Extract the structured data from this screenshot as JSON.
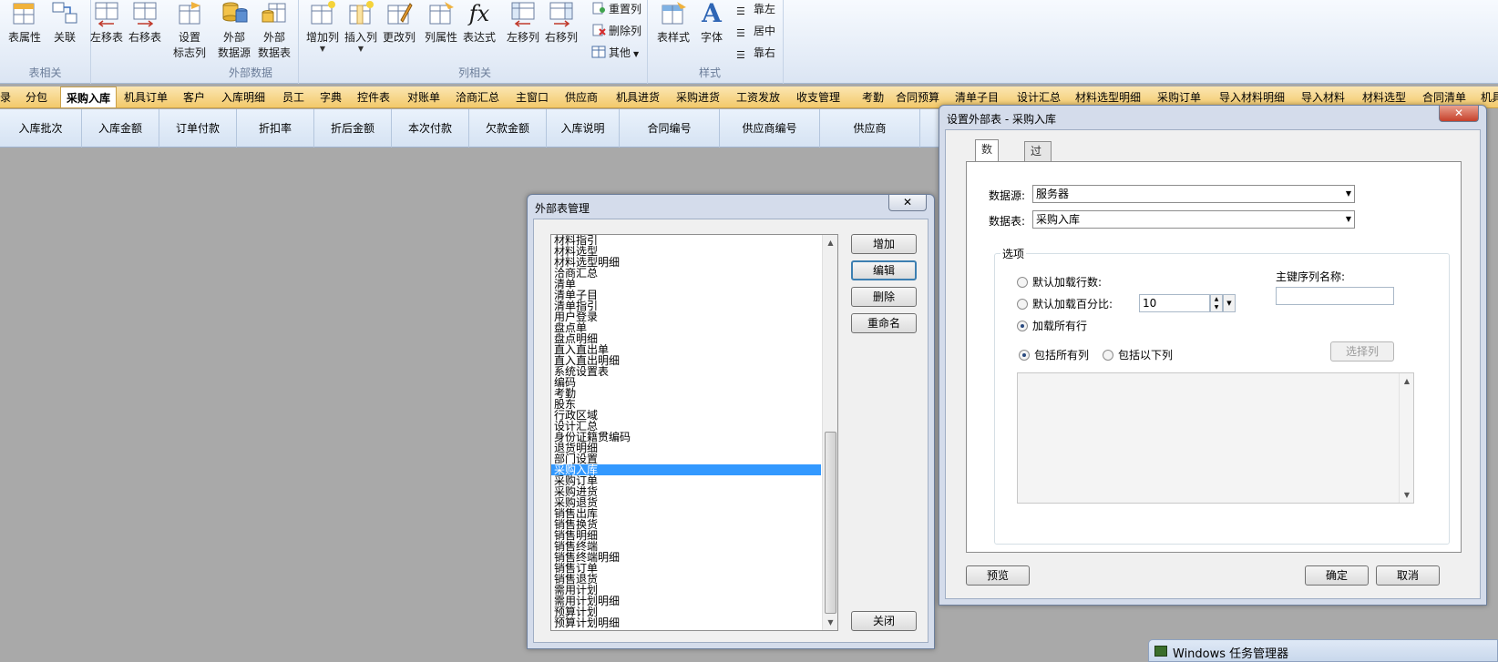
{
  "ribbon": {
    "groups": [
      {
        "label": "表相关",
        "buttons": [
          "表属性",
          "关联",
          "左移表",
          "右移表"
        ]
      },
      {
        "label": "外部数据",
        "buttons": [
          "设置\n标志列",
          "外部\n数据源",
          "外部\n数据表"
        ]
      },
      {
        "label": "列相关",
        "buttons": [
          "增加列",
          "插入列",
          "更改列",
          "列属性",
          "表达式",
          "左移列",
          "右移列"
        ]
      },
      {
        "label": "样式",
        "buttons": [
          "表样式",
          "字体"
        ]
      }
    ],
    "btn_table_props": "表属性",
    "btn_relation": "关联",
    "btn_move_table_left": "左移表",
    "btn_move_table_right": "右移表",
    "btn_flag_col_1": "设置",
    "btn_flag_col_2": "标志列",
    "btn_ext_source_1": "外部",
    "btn_ext_source_2": "数据源",
    "btn_ext_table_1": "外部",
    "btn_ext_table_2": "数据表",
    "btn_add_col": "增加列",
    "btn_insert_col": "插入列",
    "btn_change_col": "更改列",
    "btn_col_props": "列属性",
    "btn_expression": "表达式",
    "btn_move_col_left": "左移列",
    "btn_move_col_right": "右移列",
    "btn_reset_col": "重置列",
    "btn_delete_col": "删除列",
    "btn_other": "其他",
    "btn_table_style": "表样式",
    "btn_font": "字体",
    "btn_align_left": "靠左",
    "btn_align_center": "居中",
    "btn_align_right": "靠右",
    "group_table": "表相关",
    "group_external": "外部数据",
    "group_column": "列相关",
    "group_style": "样式",
    "expression_glyph": "fx",
    "font_glyph": "A"
  },
  "tabs": [
    "录",
    "分包",
    "采购入库",
    "机具订单",
    "客户",
    "入库明细",
    "员工",
    "字典",
    "控件表",
    "对账单",
    "洽商汇总",
    "主窗口",
    "供应商",
    "机具进货",
    "采购进货",
    "工资发放",
    "收支管理",
    "考勤",
    "合同预算",
    "清单子目",
    "设计汇总",
    "材料选型明细",
    "采购订单",
    "导入材料明细",
    "导入材料",
    "材料选型",
    "合同清单",
    "机具"
  ],
  "active_tab": "采购入库",
  "grid_columns": [
    "入库批次",
    "入库金额",
    "订单付款",
    "折扣率",
    "折后金额",
    "本次付款",
    "欠款金额",
    "入库说明",
    "合同编号",
    "供应商编号",
    "供应商"
  ],
  "mgr": {
    "title": "外部表管理",
    "close_glyph": "✕",
    "list_items": [
      "材料指引",
      "材料选型",
      "材料选型明细",
      "洽商汇总",
      "清单",
      "清单子目",
      "清单指引",
      "用户登录",
      "盘点单",
      "盘点明细",
      "直入直出单",
      "直入直出明细",
      "系统设置表",
      "编码",
      "考勤",
      "股东",
      "行政区域",
      "设计汇总",
      "身份证籍贯编码",
      "退货明细",
      "部门设置",
      "采购入库",
      "采购订单",
      "采购进货",
      "采购退货",
      "销售出库",
      "销售换货",
      "销售明细",
      "销售终端",
      "销售终端明细",
      "销售订单",
      "销售退货",
      "需用计划",
      "需用计划明细",
      "预算计划",
      "预算计划明细"
    ],
    "selected_item": "采购入库",
    "btn_add": "增加",
    "btn_edit": "编辑",
    "btn_delete": "删除",
    "btn_rename": "重命名",
    "btn_close": "关闭"
  },
  "cfg": {
    "title": "设置外部表 - 采购入库",
    "close_glyph": "✕",
    "tab_source": "数据源",
    "tab_filter": "过滤/排序",
    "label_source": "数据源:",
    "source_value": "服务器",
    "label_table": "数据表:",
    "table_value": "采购入库",
    "options_legend": "选项",
    "radio_rows": "默认加载行数:",
    "radio_percent": "默认加载百分比:",
    "percent_value": "10",
    "radio_all_rows": "加载所有行",
    "label_pk": "主键序列名称:",
    "pk_value": "",
    "radio_all_cols": "包括所有列",
    "radio_some_cols": "包括以下列",
    "btn_select_cols": "选择列",
    "btn_preview": "预览",
    "btn_ok": "确定",
    "btn_cancel": "取消"
  },
  "taskbar": {
    "title": "Windows 任务管理器"
  }
}
